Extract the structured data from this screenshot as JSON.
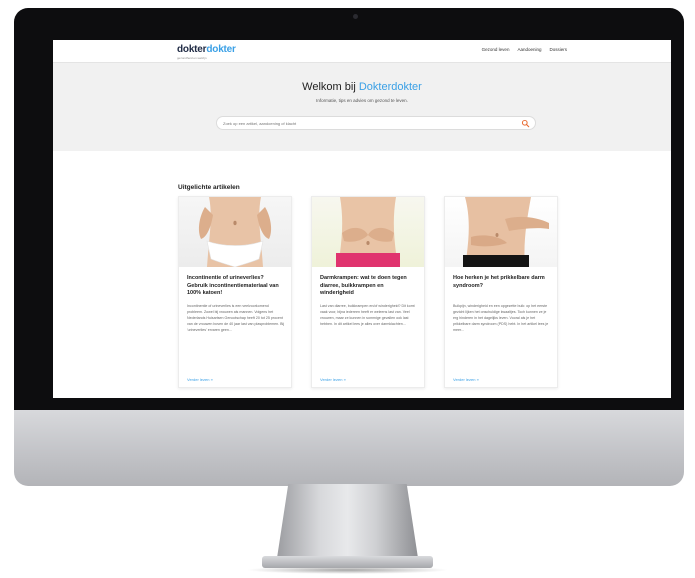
{
  "site": {
    "logo_part1": "dokter",
    "logo_part2": "dokter",
    "logo_tagline": "gezondheid en welzijn"
  },
  "nav": {
    "items": [
      {
        "label": "Gezond leven"
      },
      {
        "label": "Aandoening"
      },
      {
        "label": "Dossiers"
      }
    ]
  },
  "hero": {
    "title_prefix": "Welkom bij ",
    "title_accent": "Dokterdokter",
    "subtitle": "Informatie, tips en advies om gezond te leven.",
    "search_placeholder": "Zoek op een artikel, aandoening of klacht"
  },
  "featured": {
    "heading": "Uitgelichte artikelen",
    "articles": [
      {
        "title": "Incontinentie of urineverlies? Gebruik incontinentiemateriaal van 100% katoen!",
        "excerpt": "Incontinentie of urineverlies is een veelvoorkomend probleem. Zowel bij vrouwen als mannen. Volgens het Nederlands Huisartsen Genootschap heeft 20 tot 25 procent van de vrouwen boven de 40 jaar last van plasproblemen. Bij 'urineverlies' ervaren geen...",
        "link": "Verder lezen »"
      },
      {
        "title": "Darmkrampen: wat te doen tegen diarree, buikkrampen en winderigheid",
        "excerpt": "Last van diarree, buikkrampen en/of winderigheid? Dit komt vaak voor, bijna iedereen heeft er weleens last van. Veel vrouwen, maar ze kunnen in sommige gevallen ook last hebben. In dit artikel lees je alles over darmklachten...",
        "link": "Verder lezen »"
      },
      {
        "title": "Hoe herken je het prikkelbare darm syndroom?",
        "excerpt": "Buikpijn, winderigheid en een opgezette buik: op het eerste gezicht lijken het onschuldige kwaaltjes. Toch kunnen ze je erg hinderen in het dagelijks leven. Vooral als je het prikkelbare darm syndroom (PDS) hebt. In het artikel lees je meer...",
        "link": "Verder lezen »"
      }
    ]
  },
  "colors": {
    "accent": "#3aa0e6",
    "logo_dark": "#1f2a44",
    "bezel": "#0d0d0f",
    "hero_bg": "#f1f1f1"
  }
}
